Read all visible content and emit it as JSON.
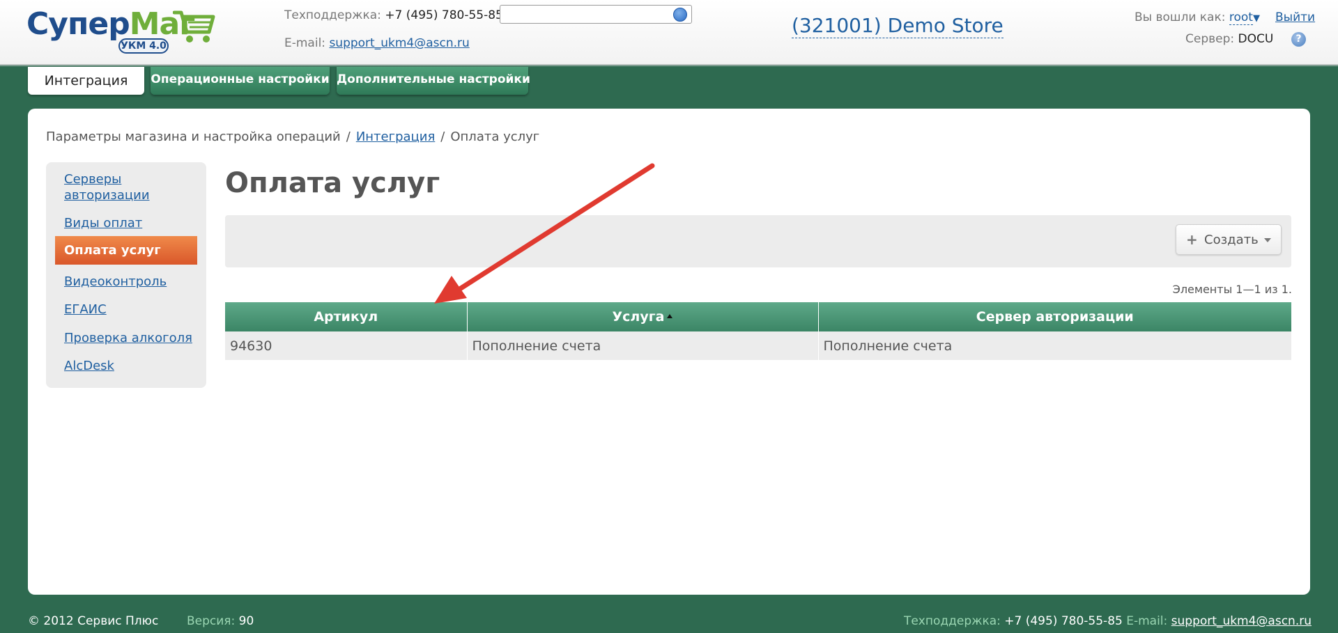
{
  "header": {
    "logo": {
      "part1": "Супер",
      "part2": "Маг",
      "badge": "УКМ 4.0"
    },
    "support_label": "Техподдержка:",
    "support_phone": "+7 (495) 780-55-85",
    "email_label": "E-mail:",
    "email": "support_ukm4@ascn.ru",
    "search_placeholder": "",
    "store": "(321001) Demo Store",
    "login_label": "Вы вошли как:",
    "user": "root",
    "logout": "Выйти",
    "server_label": "Сервер:",
    "server": "DOCU",
    "help": "?"
  },
  "tabs": [
    {
      "label": "Интеграция",
      "active": true
    },
    {
      "label": "Операционные настройки",
      "active": false
    },
    {
      "label": "Дополнительные настройки",
      "active": false
    }
  ],
  "breadcrumb": {
    "root": "Параметры магазина и настройка операций",
    "sep": "/",
    "link": "Интеграция",
    "current": "Оплата услуг"
  },
  "sidebar": {
    "items": [
      {
        "label": "Серверы авторизации"
      },
      {
        "label": "Виды оплат"
      },
      {
        "label": "Оплата услуг"
      },
      {
        "label": "Видеоконтроль"
      },
      {
        "label": "ЕГАИС"
      },
      {
        "label": "Проверка алкоголя"
      },
      {
        "label": "AlcDesk"
      }
    ]
  },
  "page": {
    "title": "Оплата услуг",
    "create_button": "Создать",
    "count_text": "Элементы 1—1 из 1."
  },
  "table": {
    "columns": [
      "Артикул",
      "Услуга",
      "Сервер авторизации"
    ],
    "rows": [
      [
        "94630",
        "Пополнение счета",
        "Пополнение счета"
      ]
    ]
  },
  "footer": {
    "copyright": "© 2012 Сервис Плюс",
    "version_label": "Версия:",
    "version": "90",
    "support_label": "Техподдержка:",
    "support_phone": "+7 (495) 780-55-85",
    "email_label": "E-mail:",
    "email": "support_ukm4@ascn.ru"
  },
  "colors": {
    "background": "#2e6a50",
    "brand_blue": "#1f4d8c",
    "brand_green": "#6fae3a",
    "accent_orange": "#d9572a",
    "table_header": "#3b8565",
    "annotation_arrow": "#e03a30"
  },
  "icons": [
    "cart-icon",
    "search-icon",
    "help-icon",
    "plus-icon",
    "caret-down-icon",
    "sort-up-icon",
    "annotation-arrow"
  ]
}
